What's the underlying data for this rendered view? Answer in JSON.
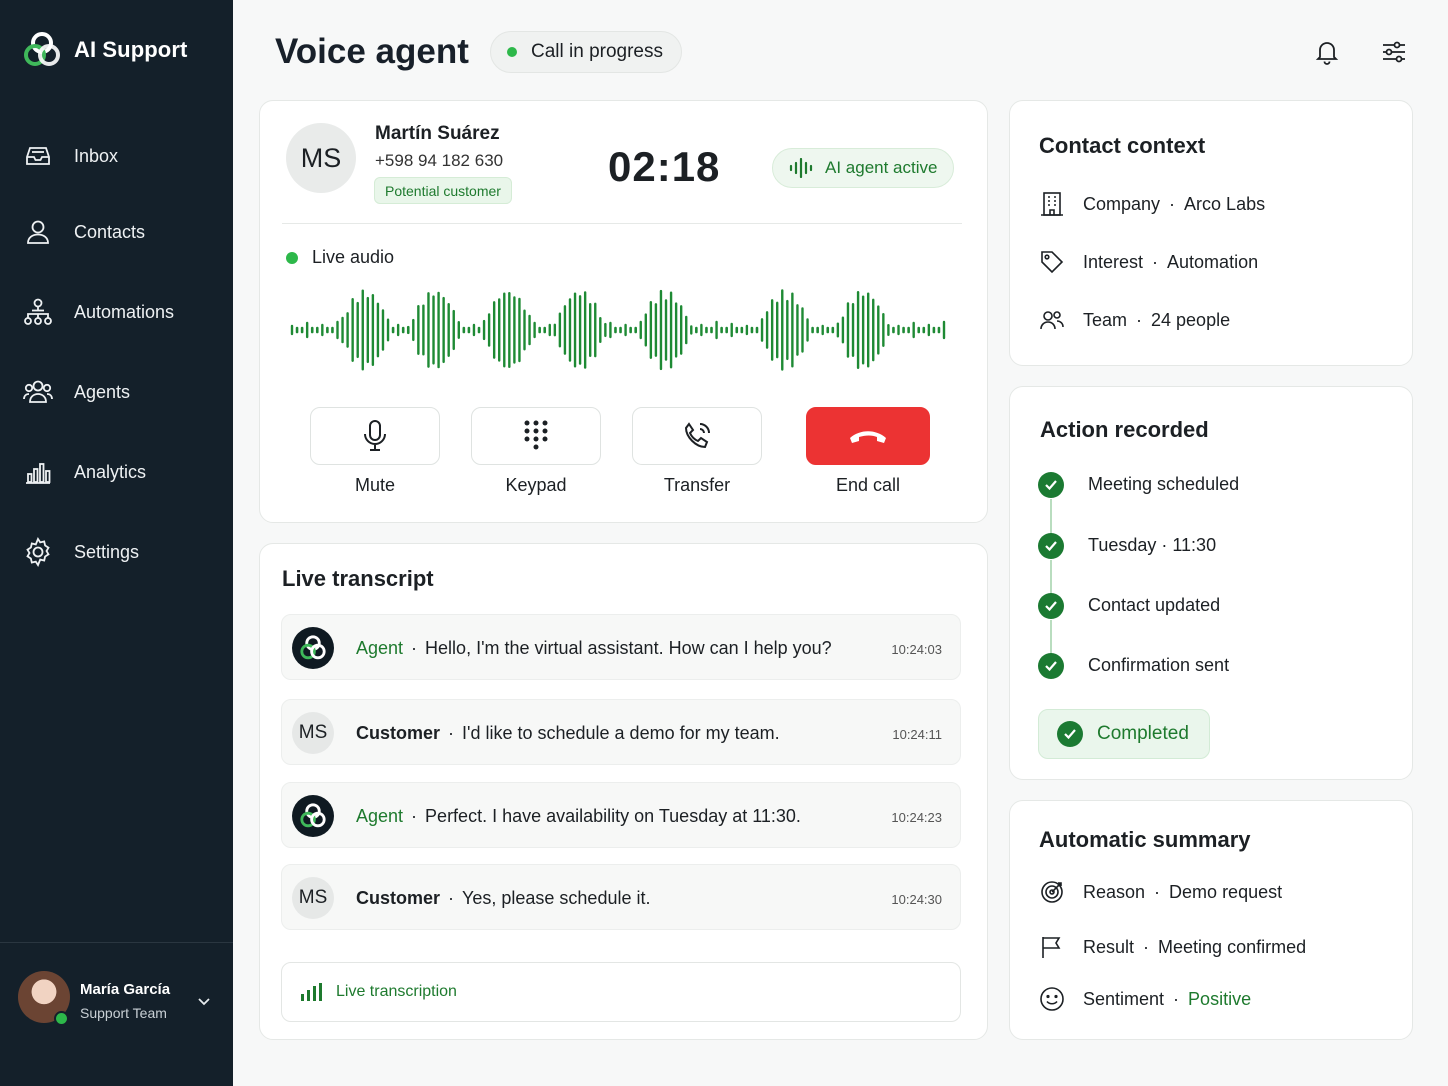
{
  "sidebar": {
    "brand": "AI Support",
    "items": [
      {
        "label": "Inbox",
        "icon": "inbox-icon"
      },
      {
        "label": "Contacts",
        "icon": "user-icon"
      },
      {
        "label": "Automations",
        "icon": "automation-icon"
      },
      {
        "label": "Agents",
        "icon": "agents-icon"
      },
      {
        "label": "Analytics",
        "icon": "analytics-icon"
      },
      {
        "label": "Settings",
        "icon": "gear-icon"
      }
    ],
    "user": {
      "name": "María García",
      "team": "Support Team"
    }
  },
  "header": {
    "title": "Voice agent",
    "status": "Call in progress"
  },
  "call": {
    "initials": "MS",
    "name": "Martín Suárez",
    "phone": "+598 94 182 630",
    "tag": "Potential customer",
    "timer": "02:18",
    "ai_status": "AI agent active",
    "live_audio_label": "Live audio",
    "controls": {
      "mute": "Mute",
      "keypad": "Keypad",
      "transfer": "Transfer",
      "end": "End call"
    }
  },
  "transcript": {
    "title": "Live transcript",
    "rows": [
      {
        "speaker": "Agent",
        "role": "agent",
        "text": "Hello, I'm the virtual assistant. How can I help you?",
        "time": "10:24:03"
      },
      {
        "speaker": "Customer",
        "role": "customer",
        "initials": "MS",
        "text": "I'd like to schedule a demo for my team.",
        "time": "10:24:11"
      },
      {
        "speaker": "Agent",
        "role": "agent",
        "text": "Perfect. I have availability on Tuesday at 11:30.",
        "time": "10:24:23"
      },
      {
        "speaker": "Customer",
        "role": "customer",
        "initials": "MS",
        "text": "Yes, please schedule it.",
        "time": "10:24:30"
      }
    ],
    "live_label": "Live transcription"
  },
  "contact_context": {
    "title": "Contact context",
    "rows": [
      {
        "key": "Company",
        "value": "Arco Labs"
      },
      {
        "key": "Interest",
        "value": "Automation"
      },
      {
        "key": "Team",
        "value": "24 people"
      }
    ]
  },
  "action_recorded": {
    "title": "Action recorded",
    "steps": [
      "Meeting scheduled",
      "Tuesday · 11:30",
      "Contact updated",
      "Confirmation sent"
    ],
    "status": "Completed"
  },
  "summary": {
    "title": "Automatic summary",
    "rows": [
      {
        "key": "Reason",
        "value": "Demo request"
      },
      {
        "key": "Result",
        "value": "Meeting confirmed"
      },
      {
        "key": "Sentiment",
        "value": "Positive"
      }
    ]
  },
  "colors": {
    "sidebar": "#14202a",
    "accent_green": "#1e7a2e",
    "live_green": "#2db84a",
    "end_call_red": "#ec3333"
  }
}
